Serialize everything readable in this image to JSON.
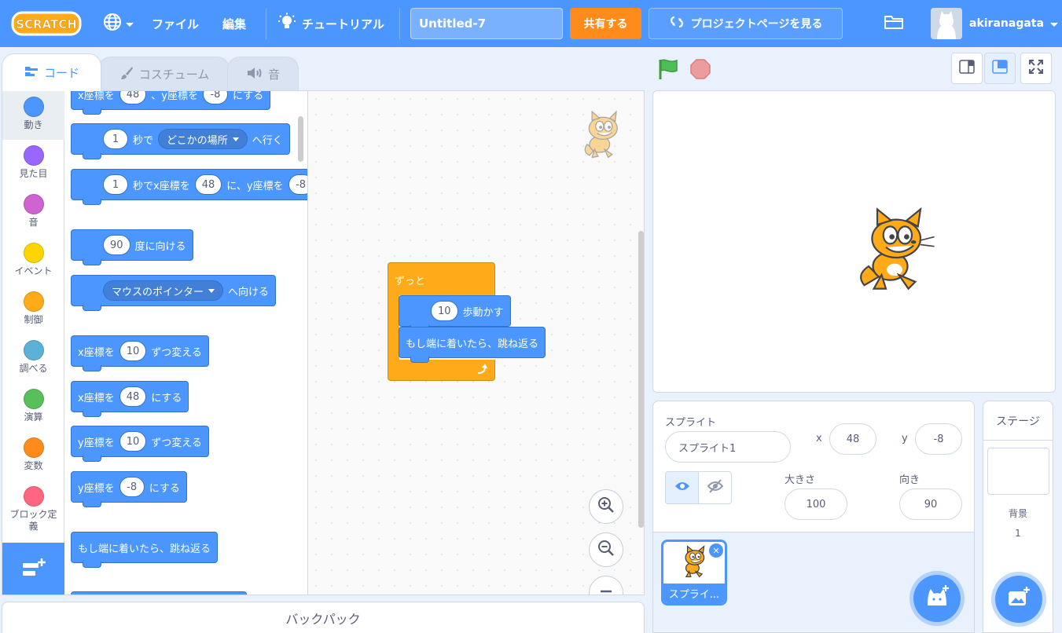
{
  "menu": {
    "file": "ファイル",
    "edit": "編集",
    "tutorials": "チュートリアル",
    "project_title": "Untitled-7",
    "share": "共有する",
    "project_page": "プロジェクトページを見る",
    "username": "akiranagata"
  },
  "tabs": {
    "code": "コード",
    "costumes": "コスチューム",
    "sounds": "音"
  },
  "categories": [
    {
      "label": "動き",
      "color": "#4c97ff"
    },
    {
      "label": "見た目",
      "color": "#9966ff"
    },
    {
      "label": "音",
      "color": "#cf63cf"
    },
    {
      "label": "イベント",
      "color": "#ffd500"
    },
    {
      "label": "制御",
      "color": "#ffab19"
    },
    {
      "label": "調べる",
      "color": "#5cb1d6"
    },
    {
      "label": "演算",
      "color": "#59c059"
    },
    {
      "label": "変数",
      "color": "#ff8c1a"
    },
    {
      "label": "ブロック定義",
      "color": "#ff6680"
    }
  ],
  "palette": {
    "goto_xy": {
      "a": "x座標を",
      "x": "48",
      "b": "、y座標を",
      "y": "-8",
      "c": "にする"
    },
    "glide_to": {
      "secs": "1",
      "a": "秒で",
      "target": "どこかの場所",
      "b": "へ行く"
    },
    "glide_xy": {
      "secs": "1",
      "a": "秒でx座標を",
      "x": "48",
      "b": "に、y座標を",
      "y": "-8"
    },
    "point_dir": {
      "deg": "90",
      "a": "度に向ける"
    },
    "point_towards": {
      "target": "マウスのポインター",
      "a": "へ向ける"
    },
    "change_x": {
      "a": "x座標を",
      "v": "10",
      "b": "ずつ変える"
    },
    "set_x": {
      "a": "x座標を",
      "v": "48",
      "b": "にする"
    },
    "change_y": {
      "a": "y座標を",
      "v": "10",
      "b": "ずつ変える"
    },
    "set_y": {
      "a": "y座標を",
      "v": "-8",
      "b": "にする"
    },
    "bounce": "もし端に着いたら、跳ね返る"
  },
  "script": {
    "forever": "ずっと",
    "move_steps": "10",
    "move_label": "歩動かす",
    "bounce": "もし端に着いたら、跳ね返る"
  },
  "backpack": "バックパック",
  "sprite": {
    "header": "スプライト",
    "name": "スプライト1",
    "x_label": "x",
    "x": "48",
    "y_label": "y",
    "y": "-8",
    "size_label": "大きさ",
    "size": "100",
    "dir_label": "向き",
    "direction": "90",
    "thumb_name": "スプライ..."
  },
  "stage_panel": {
    "header": "ステージ",
    "backdrop_label": "背景",
    "backdrop_count": "1"
  },
  "colors": {
    "menu": "#4c97ff",
    "share": "#ff8c1a",
    "control": "#ffab19",
    "motion": "#4c97ff"
  }
}
